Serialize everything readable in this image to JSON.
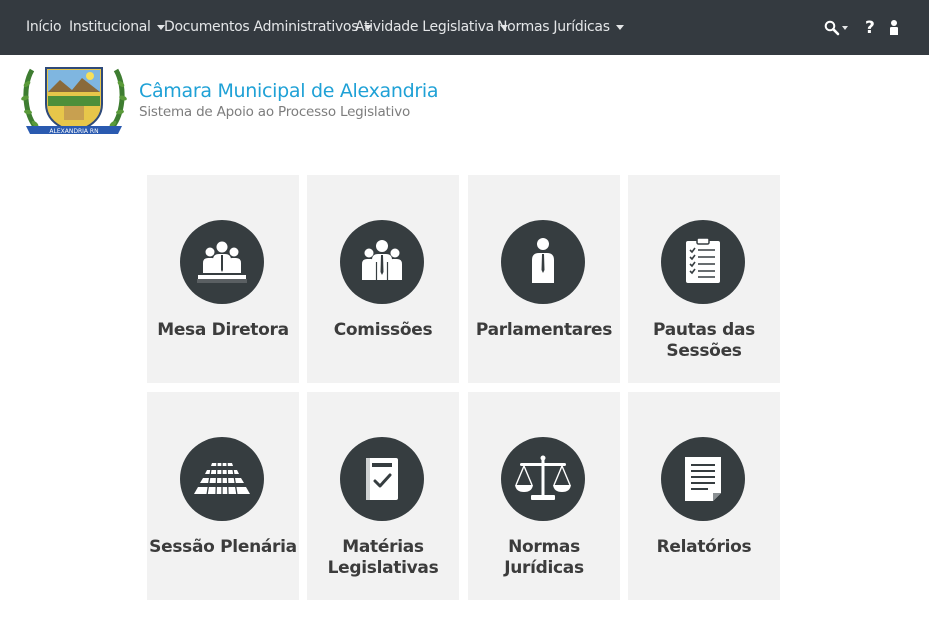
{
  "nav": {
    "inicio": "Início",
    "institucional": "Institucional",
    "documentos": "Documentos Administrativos",
    "atividade": "Atividade Legislativa",
    "normas": "Normas Jurídicas",
    "help": "?",
    "icons": [
      "search-icon",
      "help-icon",
      "user-icon"
    ]
  },
  "brand": {
    "title": "Câmara Municipal de Alexandria",
    "subtitle": "Sistema de Apoio ao Processo Legislativo",
    "seal_text": "ALEXANDRIA RN"
  },
  "tiles": [
    {
      "label": "Mesa Diretora",
      "icon": "mesa-diretora-icon"
    },
    {
      "label": "Comissões",
      "icon": "comissoes-icon"
    },
    {
      "label": "Parlamentares",
      "icon": "parlamentares-icon"
    },
    {
      "label": "Pautas das\nSessões",
      "icon": "pautas-icon"
    },
    {
      "label": "Sessão Plenária",
      "icon": "sessao-plenaria-icon"
    },
    {
      "label": "Matérias\nLegislativas",
      "icon": "materias-icon"
    },
    {
      "label": "Normas\nJurídicas",
      "icon": "normas-icon"
    },
    {
      "label": "Relatórios",
      "icon": "relatorios-icon"
    }
  ],
  "colors": {
    "navbar": "#343a40",
    "brand_title": "#1fa1d6",
    "tile_bg": "#f2f2f2",
    "icon_circle": "#363d40"
  }
}
